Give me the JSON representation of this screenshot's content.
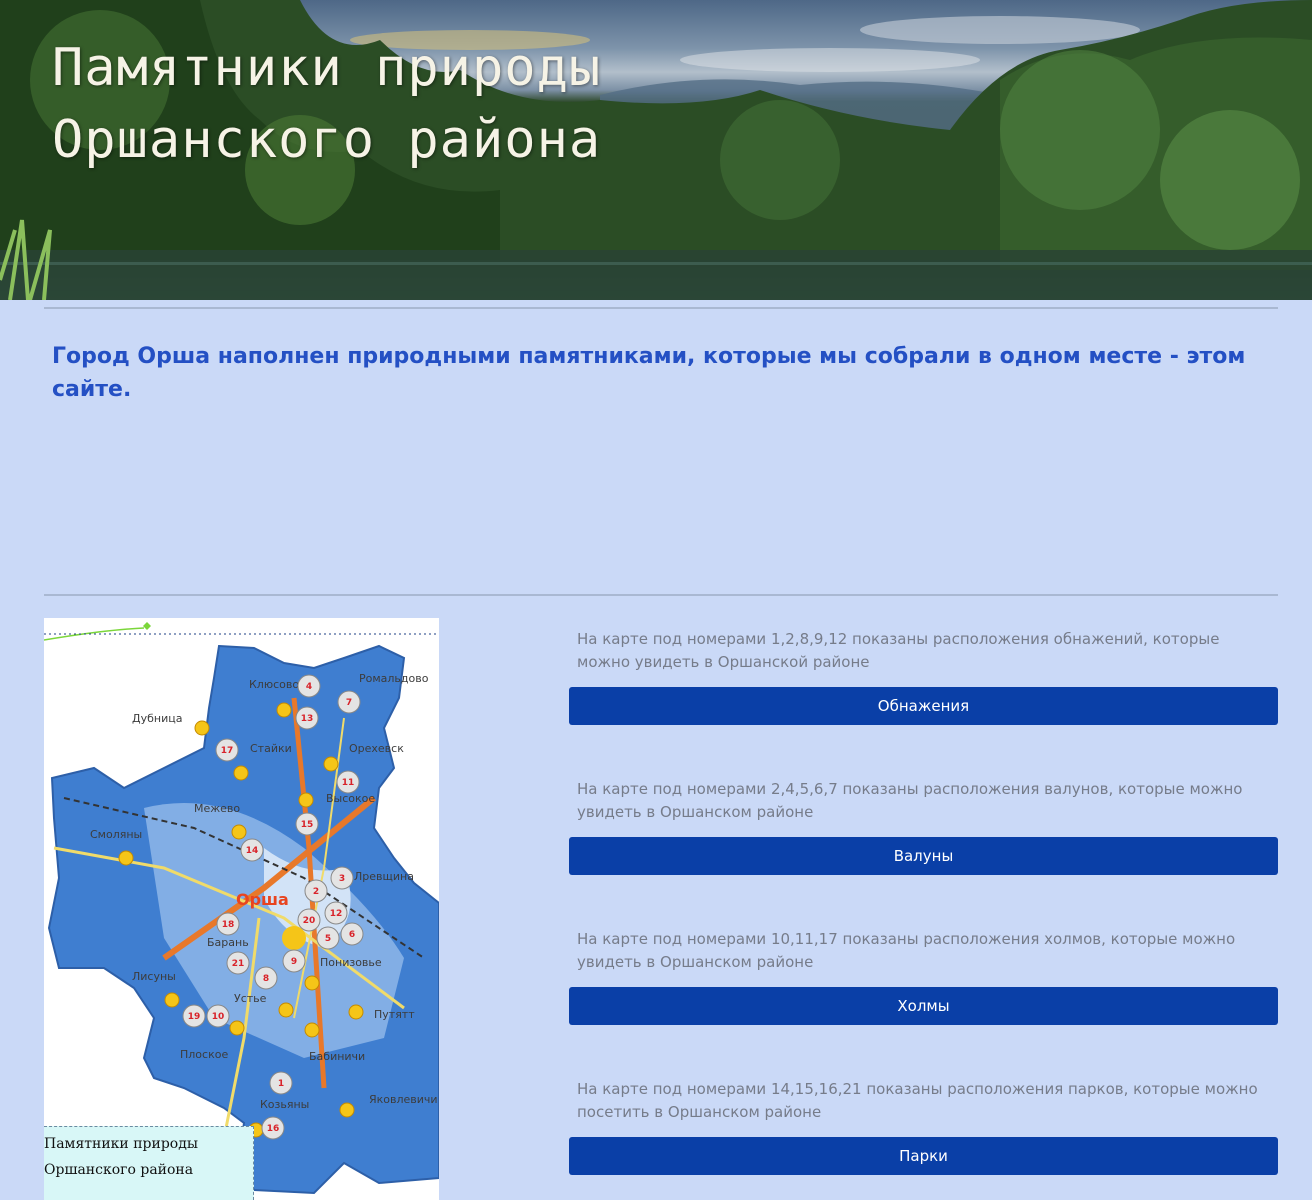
{
  "header": {
    "title": "Памятники природы\nОршанского района"
  },
  "intro": {
    "text": "Город Орша наполнен природными памятниками, которые мы собрали в одном месте - этом сайте."
  },
  "map": {
    "caption": "Памятники природы\nОршанского района",
    "city": "Орша",
    "places": [
      "Клюсово",
      "Ромальдово",
      "Дубница",
      "Стайки",
      "Орехевск",
      "Высокое",
      "Межево",
      "Смоляны",
      "Лревщина",
      "Барань",
      "Лисуны",
      "Понизовье",
      "Устье",
      "Путятт",
      "Плоское",
      "Бабиничи",
      "Козьяны",
      "Яковлевичи"
    ],
    "markers": [
      "4",
      "7",
      "13",
      "17",
      "11",
      "15",
      "14",
      "3",
      "2",
      "18",
      "20",
      "12",
      "5",
      "6",
      "21",
      "8",
      "9",
      "19",
      "10",
      "1",
      "16"
    ]
  },
  "categories": [
    {
      "description": "На карте под номерами 1,2,8,9,12 показаны расположения обнажений, которые можно увидеть в Оршанской районе",
      "button": "Обнажения"
    },
    {
      "description": "На карте под номерами 2,4,5,6,7 показаны расположения валунов, которые можно увидеть в Оршанском районе",
      "button": "Валуны"
    },
    {
      "description": "На карте под номерами 10,11,17 показаны расположения холмов, которые можно увидеть в Оршанском районе",
      "button": "Холмы"
    },
    {
      "description": "На карте под номерами 14,15,16,21 показаны расположения парков, которые можно посетить в Оршанском районе",
      "button": "Парки"
    }
  ],
  "colors": {
    "page_bg": "#cad9f7",
    "intro_text": "#2450c4",
    "button_bg": "#0a3fa7",
    "button_text": "#ffffff",
    "description_text": "#767c8a"
  }
}
